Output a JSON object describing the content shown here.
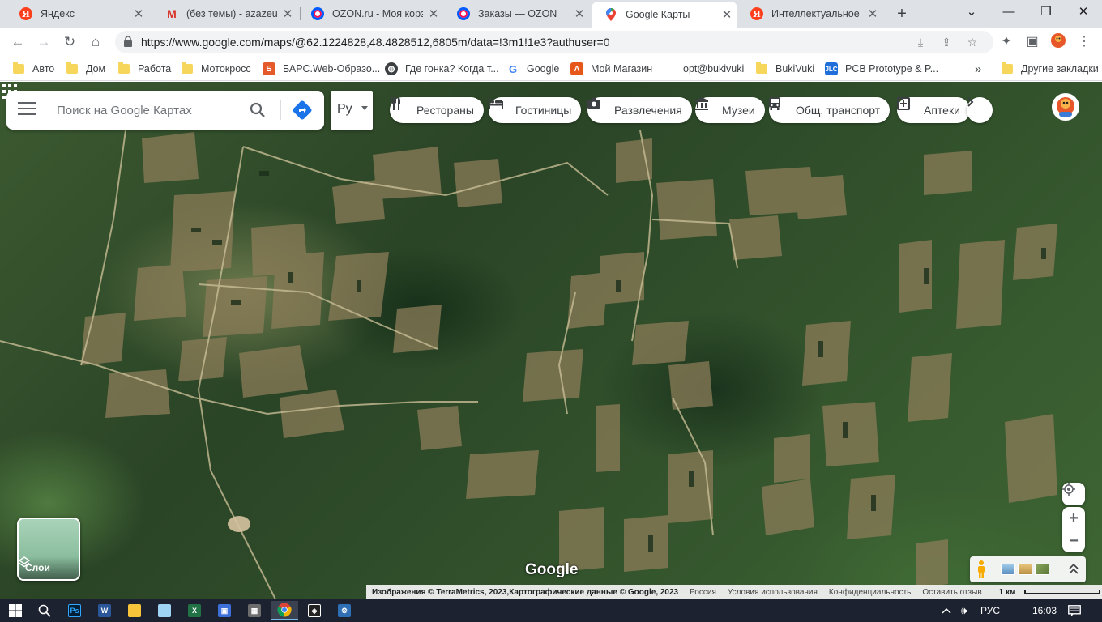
{
  "browser": {
    "tabs": [
      {
        "title": "Яндекс",
        "icon": "yandex-icon",
        "active": false
      },
      {
        "title": "(без темы) - azazeulus",
        "icon": "gmail-icon",
        "active": false
      },
      {
        "title": "OZON.ru - Моя корзина",
        "icon": "ozon-icon",
        "active": false
      },
      {
        "title": "Заказы — OZON",
        "icon": "ozon-icon",
        "active": false
      },
      {
        "title": "Google Карты",
        "icon": "google-maps-icon",
        "active": true
      },
      {
        "title": "Интеллектуальное Ма",
        "icon": "yandex-icon",
        "active": false
      }
    ],
    "url": "https://www.google.com/maps/@62.1224828,48.4828512,6805m/data=!3m1!1e3?authuser=0",
    "bookmarks": [
      {
        "label": "Авто",
        "type": "folder"
      },
      {
        "label": "Дом",
        "type": "folder"
      },
      {
        "label": "Работа",
        "type": "folder"
      },
      {
        "label": "Мотокросс",
        "type": "folder"
      },
      {
        "label": "БАРС.Web-Образо...",
        "type": "site"
      },
      {
        "label": "Где гонка? Когда т...",
        "type": "site"
      },
      {
        "label": "Google",
        "type": "site"
      },
      {
        "label": "Мой Магазин",
        "type": "site"
      },
      {
        "label": "opt@bukivuki",
        "type": "site"
      },
      {
        "label": "BukiVuki",
        "type": "folder"
      },
      {
        "label": "PCB Prototype & P...",
        "type": "site"
      }
    ],
    "bookmarks_more": "»",
    "other_bookmarks": "Другие закладки"
  },
  "maps": {
    "search_placeholder": "Поиск на Google Картах",
    "language": "Ру",
    "chips": [
      {
        "label": "Рестораны",
        "icon": "fork-knife-icon"
      },
      {
        "label": "Гостиницы",
        "icon": "bed-icon"
      },
      {
        "label": "Развлечения",
        "icon": "camera-icon"
      },
      {
        "label": "Музеи",
        "icon": "museum-icon"
      },
      {
        "label": "Общ. транспорт",
        "icon": "bus-icon"
      },
      {
        "label": "Аптеки",
        "icon": "pharmacy-icon"
      }
    ],
    "layers_label": "Слои",
    "google_logo": "Google",
    "attribution": {
      "imagery": "Изображения © TerraMetrics, 2023,Картографические данные © Google, 2023",
      "country": "Россия",
      "terms": "Условия использования",
      "privacy": "Конфиденциальность",
      "feedback": "Оставить отзыв",
      "scale": "1 км"
    }
  },
  "taskbar": {
    "lang": "РУС",
    "time": "16:03"
  },
  "colors": {
    "accent": "#1a73e8",
    "map_forest": "#2a4426",
    "map_clearing": "#8a7a55"
  }
}
